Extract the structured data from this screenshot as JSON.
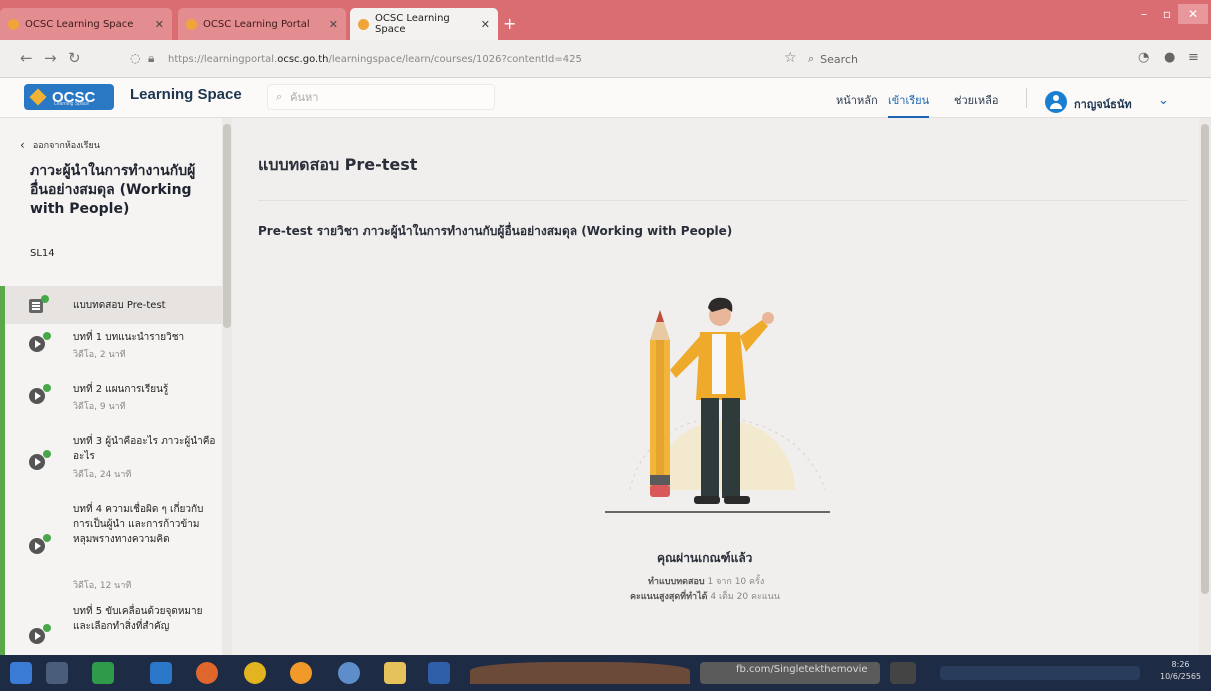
{
  "browser": {
    "tabs": [
      {
        "label": "OCSC Learning Space",
        "active": false
      },
      {
        "label": "OCSC Learning Portal",
        "active": false
      },
      {
        "label": "OCSC Learning Space",
        "active": true
      }
    ],
    "url_prefix": "https://learningportal.",
    "url_domain": "ocsc.go.th",
    "url_suffix": "/learningspace/learn/courses/1026?contentId=425",
    "search_placeholder": "Search"
  },
  "header": {
    "logo_text": "OCSC",
    "logo_sub": "Learning Space",
    "app_name": "Learning Space",
    "search_placeholder": "ค้นหา",
    "menu": [
      "หน้าหลัก",
      "เข้าเรียน",
      "ช่วยเหลือ"
    ],
    "active_menu": "เข้าเรียน",
    "user_name": "กาญจน์ธนัท"
  },
  "sidebar": {
    "back_label": "ออกจากห้องเรียน",
    "course_title": "ภาวะผู้นำในการทำงานกับผู้อื่นอย่างสมดุล (Working with People)",
    "course_code": "SL14",
    "lessons": [
      {
        "title": "แบบทดสอบ Pre-test",
        "duration": "",
        "icon": "quiz-icon"
      },
      {
        "title": "บทที่ 1 บทแนะนำรายวิชา",
        "duration": "วิดีโอ, 2 นาที",
        "icon": "play-icon"
      },
      {
        "title": "บทที่ 2 แผนการเรียนรู้",
        "duration": "วิดีโอ, 9 นาที",
        "icon": "play-icon"
      },
      {
        "title": "บทที่ 3 ผู้นำคืออะไร ภาวะผู้นำคืออะไร",
        "duration": "วิดีโอ, 24 นาที",
        "icon": "play-icon"
      },
      {
        "title": "บทที่ 4 ความเชื่อผิด ๆ เกี่ยวกับการเป็นผู้นำ และการก้าวข้ามหลุมพรางทางความคิด",
        "duration": "วิดีโอ, 12 นาที",
        "icon": "play-icon"
      },
      {
        "title": "บทที่ 5 ขับเคลื่อนด้วยจุดหมาย และเลือกทำสิ่งที่สำคัญ",
        "duration": "",
        "icon": "play-icon"
      }
    ]
  },
  "main": {
    "page_title": "แบบทดสอบ Pre-test",
    "quiz_title": "Pre-test รายวิชา ภาวะผู้นำในการทำงานกับผู้อื่นอย่างสมดุล (Working with People)",
    "result_title": "คุณผ่านเกณฑ์แล้ว",
    "attempts_label": "ทำแบบทดสอบ",
    "attempts_value": "1 จาก 10 ครั้ง",
    "best_label": "คะแนนสูงสุดที่ทำได้",
    "best_value": "4 เต็ม 20 คะแนน"
  },
  "taskbar": {
    "note": "fb.com/Singletekthemovie",
    "time": "8:26",
    "date": "10/6/2565"
  },
  "colors": {
    "brand_blue": "#2a78c4",
    "active_menu": "#1d63b3",
    "complete_green": "#47a84a",
    "browser_tab": "#d96d72"
  }
}
